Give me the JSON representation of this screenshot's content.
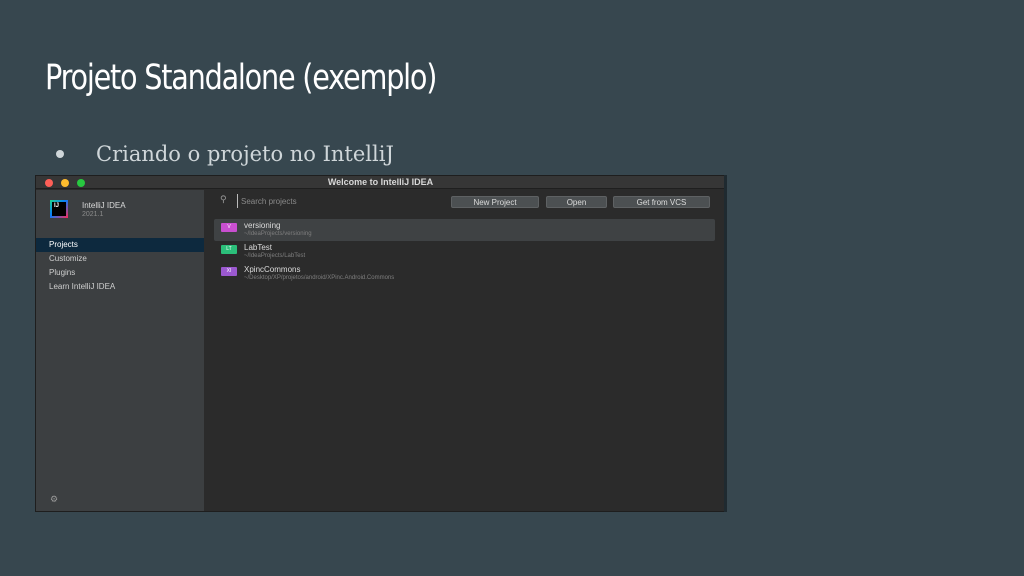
{
  "slide": {
    "title": "Projeto Standalone (exemplo)",
    "bullet": "Criando o projeto no IntelliJ"
  },
  "window": {
    "title": "Welcome to IntelliJ IDEA",
    "app_logo_text": "IJ",
    "app_name": "IntelliJ IDEA",
    "app_version": "2021.1",
    "nav": [
      {
        "label": "Projects",
        "active": true
      },
      {
        "label": "Customize",
        "active": false
      },
      {
        "label": "Plugins",
        "active": false
      },
      {
        "label": "Learn IntelliJ IDEA",
        "active": false
      }
    ],
    "search_placeholder": "Search projects",
    "buttons": {
      "new_project": "New Project",
      "open": "Open",
      "get_from_vcs": "Get from VCS"
    },
    "projects": [
      {
        "badge": "V",
        "badge_color": "#c94fd0",
        "name": "versioning",
        "path": "~/IdeaProjects/versioning",
        "selected": true
      },
      {
        "badge": "LT",
        "badge_color": "#2bbf7a",
        "name": "LabTest",
        "path": "~/IdeaProjects/LabTest",
        "selected": false
      },
      {
        "badge": "XI",
        "badge_color": "#9b59d0",
        "name": "XpincCommons",
        "path": "~/Desktop/XP/projetos/android/XPinc.Android.Commons",
        "selected": false
      }
    ]
  },
  "colors": {
    "slide_background": "#37474f",
    "selected_nav": "#0d293e"
  }
}
